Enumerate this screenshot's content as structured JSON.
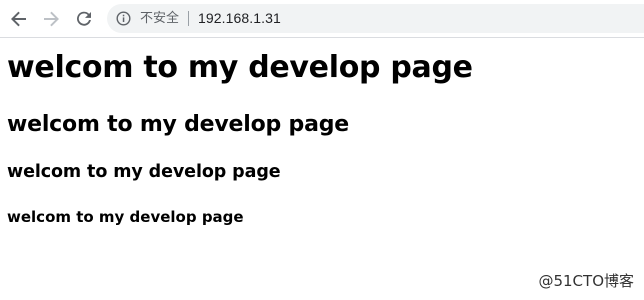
{
  "browser": {
    "security_label": "不安全",
    "url": "192.168.1.31"
  },
  "page": {
    "h1": "welcom to my develop page",
    "h2": "welcom to my develop page",
    "h3": "welcom to my develop page",
    "h4": "welcom to my develop page"
  },
  "watermark": "@51CTO博客",
  "icons": {
    "back": "arrow-left-icon",
    "forward": "arrow-right-icon",
    "reload": "reload-icon",
    "info": "info-circle-icon"
  },
  "colors": {
    "toolbar_icon": "#5f6368",
    "disabled_icon": "#bdc1c6",
    "omnibox_bg": "#f1f3f4"
  }
}
